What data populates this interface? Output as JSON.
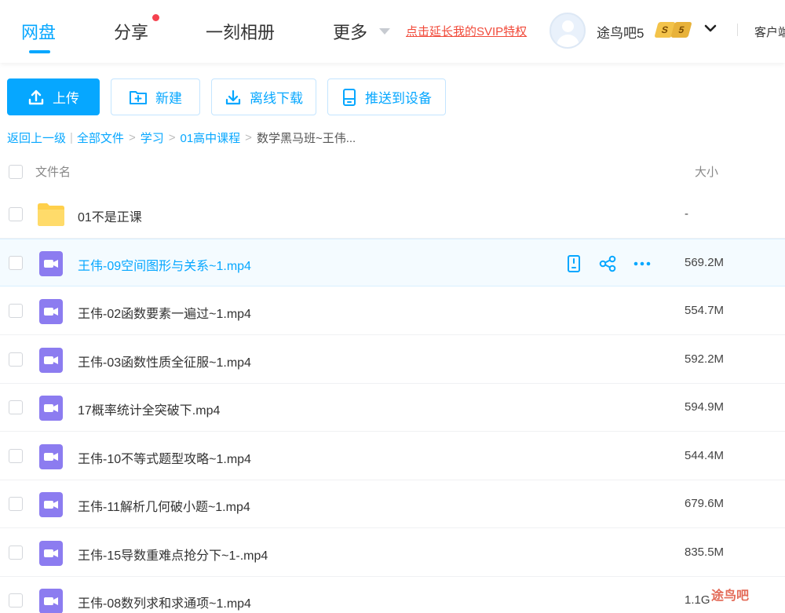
{
  "nav": {
    "items": [
      {
        "label": "网盘",
        "active": true
      },
      {
        "label": "分享",
        "active": false,
        "has_dot": true
      },
      {
        "label": "一刻相册",
        "active": false
      },
      {
        "label": "更多",
        "active": false,
        "has_caret": true
      }
    ],
    "svip_link": "点击延长我的SVIP特权",
    "username": "途鸟吧5",
    "vip_badge": {
      "left": "S",
      "right": "5"
    },
    "client_link": "客户端"
  },
  "toolbar": {
    "upload": "上传",
    "new_folder": "新建",
    "offline_download": "离线下载",
    "push_to_device": "推送到设备"
  },
  "breadcrumb": {
    "back": "返回上一级",
    "items": [
      "全部文件",
      "学习",
      "01高中课程"
    ],
    "current": "数学黑马班~王伟..."
  },
  "table": {
    "header_name": "文件名",
    "header_size": "大小",
    "rows": [
      {
        "type": "folder",
        "name": "01不是正课",
        "size": "-"
      },
      {
        "type": "video",
        "name": "王伟-09空间图形与关系~1.mp4",
        "size": "569.2M",
        "hover": true
      },
      {
        "type": "video",
        "name": "王伟-02函数要素一遍过~1.mp4",
        "size": "554.7M"
      },
      {
        "type": "video",
        "name": "王伟-03函数性质全征服~1.mp4",
        "size": "592.2M"
      },
      {
        "type": "video",
        "name": "17概率统计全突破下.mp4",
        "size": "594.9M"
      },
      {
        "type": "video",
        "name": "王伟-10不等式题型攻略~1.mp4",
        "size": "544.4M"
      },
      {
        "type": "video",
        "name": "王伟-11解析几何破小题~1.mp4",
        "size": "679.6M"
      },
      {
        "type": "video",
        "name": "王伟-15导数重难点抢分下~1-.mp4",
        "size": "835.5M"
      },
      {
        "type": "video",
        "name": "王伟-08数列求和求通项~1.mp4",
        "size": "1.1G"
      }
    ]
  },
  "watermark": "途鸟吧",
  "colors": {
    "accent": "#06a7ff",
    "svip_red": "#f14a3a",
    "folder": "#ffd04b",
    "video": "#8c7cf0"
  }
}
